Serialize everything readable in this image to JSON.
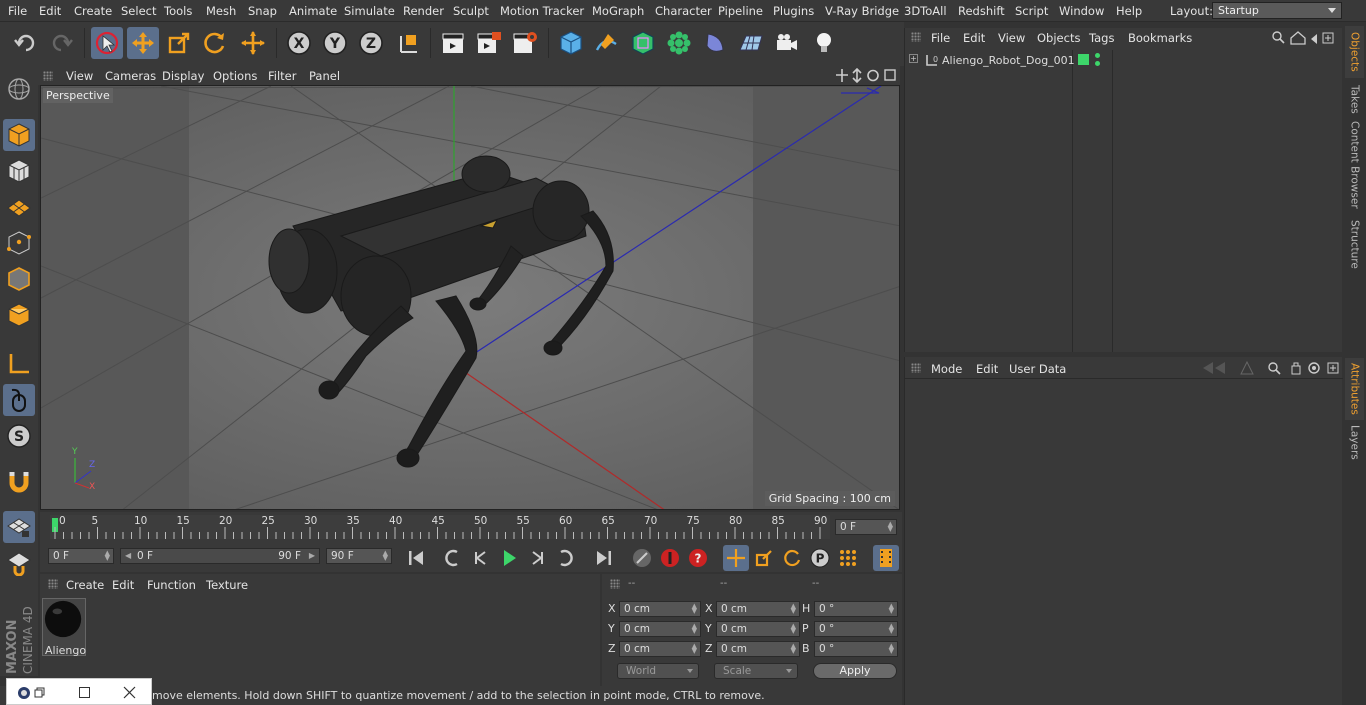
{
  "menubar": {
    "items": [
      "File",
      "Edit",
      "Create",
      "Select",
      "Tools",
      "Mesh",
      "Snap",
      "Animate",
      "Simulate",
      "Render",
      "Sculpt",
      "Motion Tracker",
      "MoGraph",
      "Character",
      "Pipeline",
      "Plugins",
      "V-Ray Bridge",
      "3DToAll",
      "Redshift",
      "Script",
      "Window",
      "Help"
    ],
    "layout_label": "Layout:",
    "layout_value": "Startup"
  },
  "viewport": {
    "menu": [
      "View",
      "Cameras",
      "Display",
      "Options",
      "Filter",
      "Panel"
    ],
    "label": "Perspective",
    "grid_spacing": "Grid Spacing : 100 cm",
    "axis_labels": {
      "x": "X",
      "y": "Y",
      "z": "Z"
    }
  },
  "timeline": {
    "ticks": [
      "0",
      "5",
      "10",
      "15",
      "20",
      "25",
      "30",
      "35",
      "40",
      "45",
      "50",
      "55",
      "60",
      "65",
      "70",
      "75",
      "80",
      "85",
      "90"
    ],
    "current_frame_field": "0 F"
  },
  "anim": {
    "start_field": "0 F",
    "range_start": "0 F",
    "range_end": "90 F",
    "end_field": "90 F"
  },
  "material": {
    "menu": [
      "Create",
      "Edit",
      "Function",
      "Texture"
    ],
    "name": "Aliengo"
  },
  "coords": {
    "headers": [
      "--",
      "--",
      "--"
    ],
    "rows": [
      {
        "l1": "X",
        "v1": "0 cm",
        "l2": "X",
        "v2": "0 cm",
        "l3": "H",
        "v3": "0 °"
      },
      {
        "l1": "Y",
        "v1": "0 cm",
        "l2": "Y",
        "v2": "0 cm",
        "l3": "P",
        "v3": "0 °"
      },
      {
        "l1": "Z",
        "v1": "0 cm",
        "l2": "Z",
        "v2": "0 cm",
        "l3": "B",
        "v3": "0 °"
      }
    ],
    "mode_select": "World",
    "scale_select": "Scale",
    "apply_label": "Apply"
  },
  "objects": {
    "menu": [
      "File",
      "Edit",
      "View",
      "Objects",
      "Tags",
      "Bookmarks"
    ],
    "item_name": "Aliengo_Robot_Dog_001"
  },
  "attributes": {
    "menu": [
      "Mode",
      "Edit",
      "User Data"
    ]
  },
  "right_tabs": [
    "Objects",
    "Takes",
    "Content Browser",
    "Structure",
    "Attributes",
    "Layers"
  ],
  "status": {
    "text": "move elements. Hold down SHIFT to quantize movement / add to the selection in point mode, CTRL to remove."
  },
  "branding": {
    "logo": "MAXON CINEMA 4D"
  },
  "colors": {
    "accent": "#5b6f8c",
    "active_tab": "#f0a030",
    "viewport_bg": "#707070"
  }
}
